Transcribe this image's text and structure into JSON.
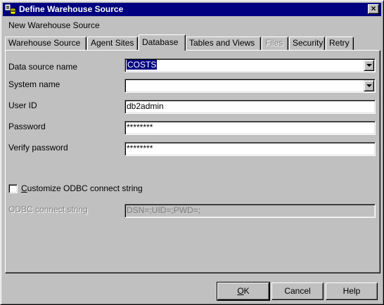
{
  "window": {
    "title": "Define Warehouse Source",
    "close_label": "×",
    "subtitle": "New Warehouse Source"
  },
  "tabs": [
    {
      "label": "Warehouse Source",
      "state": "normal"
    },
    {
      "label": "Agent Sites",
      "state": "normal"
    },
    {
      "label": "Database",
      "state": "active"
    },
    {
      "label": "Tables and Views",
      "state": "normal"
    },
    {
      "label": "Files",
      "state": "disabled"
    },
    {
      "label": "Security",
      "state": "normal"
    },
    {
      "label": "Retry",
      "state": "normal"
    }
  ],
  "form": {
    "data_source_name": {
      "label": "Data source name",
      "value": "COSTS"
    },
    "system_name": {
      "label": "System name",
      "value": ""
    },
    "user_id": {
      "label": "User ID",
      "value": "db2admin"
    },
    "password": {
      "label": "Password",
      "value": "********"
    },
    "verify_password": {
      "label": "Verify password",
      "value": "********"
    },
    "customize_odbc": {
      "label_prefix": "C",
      "label_rest": "ustomize ODBC connect string",
      "checked": false
    },
    "odbc_connect_string": {
      "label": "ODBC connect string",
      "value": "DSN=;UID=;PWD=;",
      "disabled": true
    }
  },
  "buttons": {
    "ok": {
      "mnemonic": "O",
      "rest": "K"
    },
    "cancel": "Cancel",
    "help": "Help"
  },
  "colors": {
    "titlebar": "#000080",
    "face": "#c0c0c0",
    "selection": "#000080"
  },
  "icons": [
    "warehouse-source-icon",
    "close-icon",
    "dropdown-arrow-icon"
  ]
}
